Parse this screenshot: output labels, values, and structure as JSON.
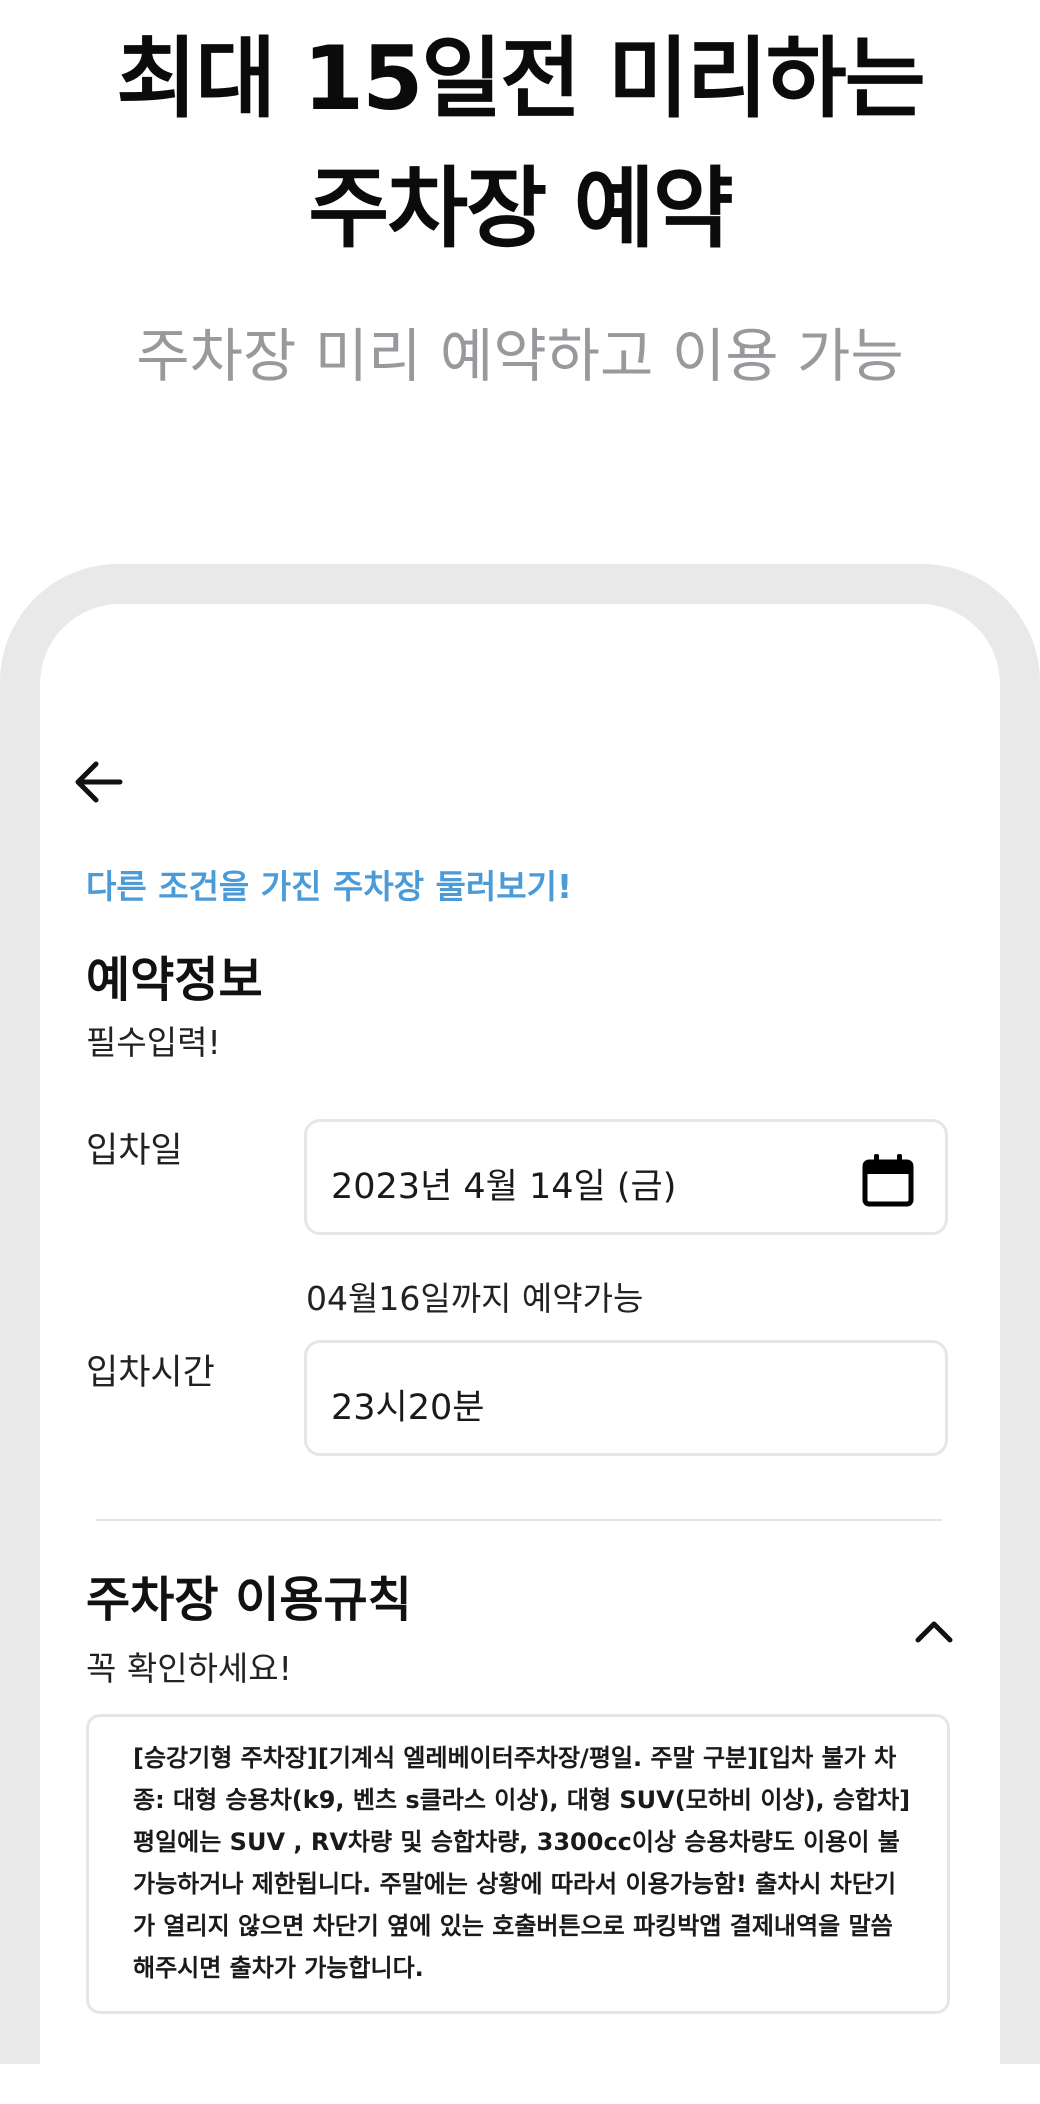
{
  "hero": {
    "title_line1": "최대 15일전 미리하는",
    "title_line2": "주차장 예약",
    "subtitle": "주차장 미리 예약하고 이용 가능"
  },
  "screen": {
    "back_icon": "arrow-left-icon",
    "browse_link": "다른 조건을 가진 주차장 둘러보기!",
    "reservation": {
      "title": "예약정보",
      "note": "필수입력!",
      "date_label": "입차일",
      "date_value": "2023년 4월 14일 (금)",
      "date_icon": "calendar-icon",
      "date_hint": "04월16일까지 예약가능",
      "time_label": "입차시간",
      "time_value": "23시20분"
    },
    "rules": {
      "title": "주차장 이용규칙",
      "note": "꼭 확인하세요!",
      "toggle_icon": "chevron-up-icon",
      "text": "[승강기형 주차장][기계식 엘레베이터주차장/평일. 주말 구분][입차 불가 차종: 대형 승용차(k9, 벤츠 s클라스 이상), 대형 SUV(모하비 이상), 승합차] 평일에는 SUV , RV차량 및 승합차량, 3300cc이상 승용차량도 이용이 불가능하거나 제한됩니다. 주말에는 상황에 따라서 이용가능함! 출차시 차단기가 열리지 않으면 차단기 옆에 있는 호출버튼으로 파킹박앱 결제내역을 말씀해주시면 출차가 가능합니다."
    }
  },
  "colors": {
    "link": "#4a9bd8",
    "subtitle": "#98999c",
    "frame": "#e9e9ea"
  }
}
